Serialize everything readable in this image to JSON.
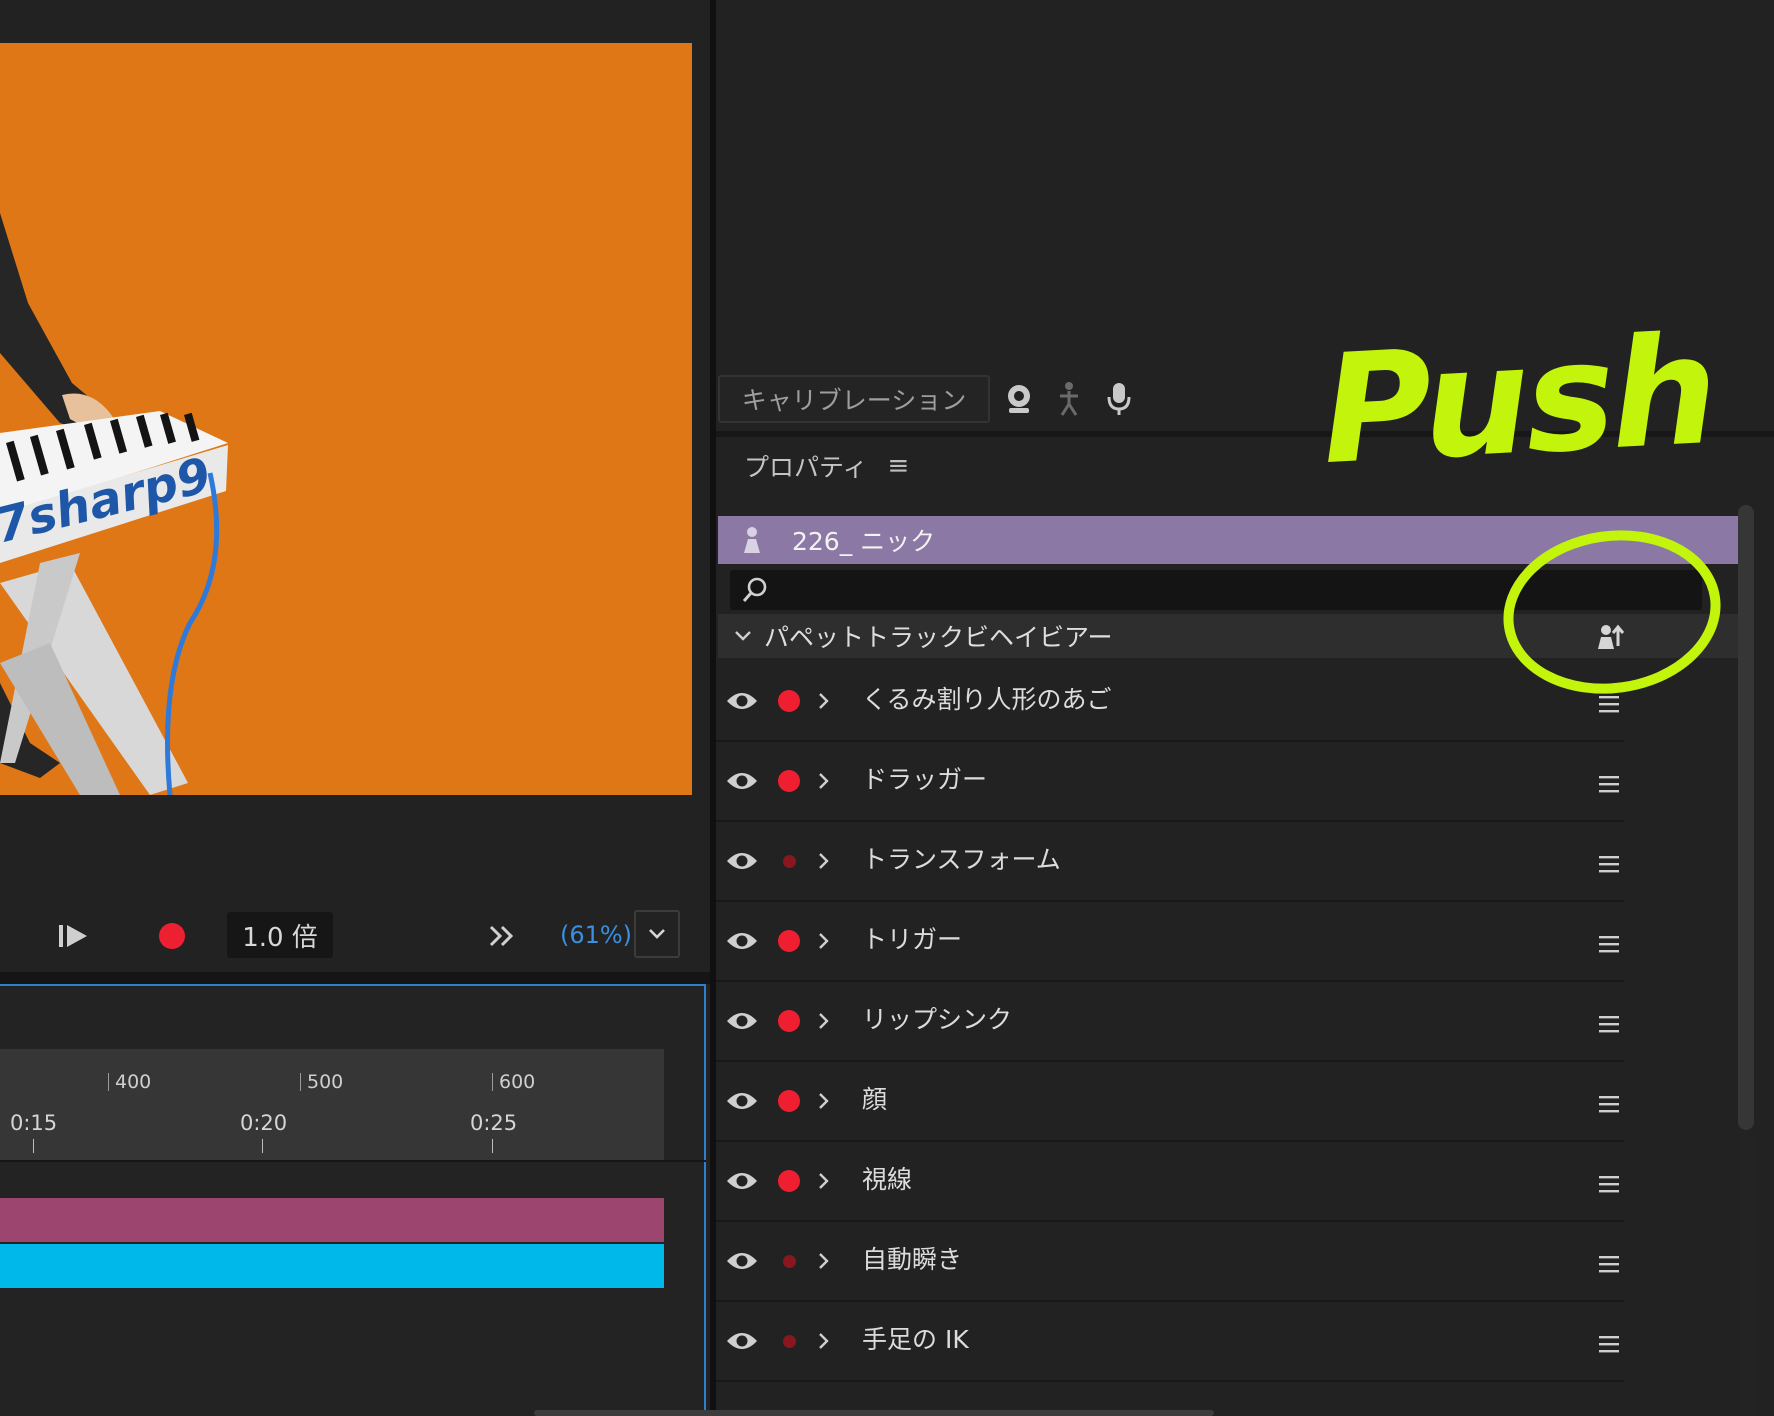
{
  "scene": {
    "logo_text": "7sharp9",
    "background_color": "#df7716"
  },
  "transport": {
    "speed_label": "1.0 倍",
    "zoom_label": "(61%)",
    "record_color": "#ec2030"
  },
  "timeline": {
    "frame_ticks": [
      "400",
      "500",
      "600"
    ],
    "time_ticks": [
      "0:15",
      "0:20",
      "0:25"
    ],
    "puppet_bar_color": "#9c456e",
    "audio_bar_color": "#00b8ea"
  },
  "calibration": {
    "label": "キャリブレーション",
    "icons": [
      "webcam-icon",
      "body-icon",
      "microphone-icon"
    ]
  },
  "properties": {
    "title": "プロパティ",
    "puppet_name": "226_ ニック",
    "puppet_color": "#8c78a4",
    "search_placeholder": "",
    "group_title": "パペットトラックビヘイビアー",
    "behaviors": [
      {
        "label": "くるみ割り人形のあご",
        "armed": true
      },
      {
        "label": "ドラッガー",
        "armed": true
      },
      {
        "label": "トランスフォーム",
        "armed": false
      },
      {
        "label": "トリガー",
        "armed": true
      },
      {
        "label": "リップシンク",
        "armed": true
      },
      {
        "label": "顔",
        "armed": true
      },
      {
        "label": "視線",
        "armed": true
      },
      {
        "label": "自動瞬き",
        "armed": false
      },
      {
        "label": "手足の IK",
        "armed": false
      }
    ]
  },
  "annotation": {
    "text": "Push",
    "color": "#c3f40b"
  }
}
